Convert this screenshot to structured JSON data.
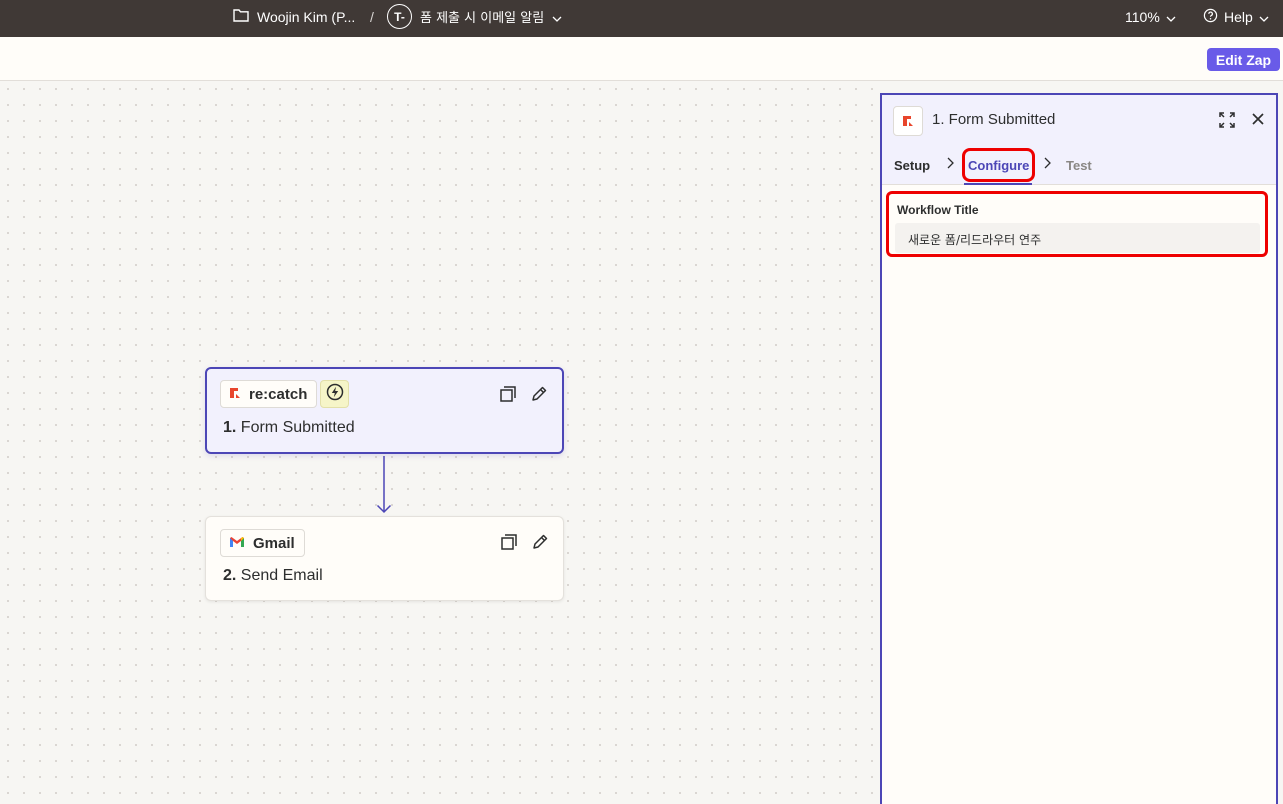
{
  "topbar": {
    "folder_name": "Woojin Kim (P...",
    "separator": "/",
    "zap_badge": "T-",
    "zap_name": "폼 제출 시 이메일 알림",
    "zoom": "110%",
    "help": "Help"
  },
  "subbar": {
    "edit_label": "Edit Zap"
  },
  "canvas": {
    "steps": [
      {
        "app": "re:catch",
        "number": "1.",
        "title": "Form Submitted",
        "trigger": true,
        "selected": true
      },
      {
        "app": "Gmail",
        "number": "2.",
        "title": "Send Email",
        "trigger": false,
        "selected": false
      }
    ]
  },
  "panel": {
    "title": "1. Form Submitted",
    "tabs": [
      "Setup",
      "Configure",
      "Test"
    ],
    "active_tab": "Configure",
    "field": {
      "label": "Workflow Title",
      "value": "새로운 폼/리드라우터 연주"
    }
  },
  "colors": {
    "topbar": "#403936",
    "accent": "#695be8",
    "selected_border": "#4c46b6",
    "highlight": "#e00000",
    "recatch_brand": "#e8452c"
  }
}
